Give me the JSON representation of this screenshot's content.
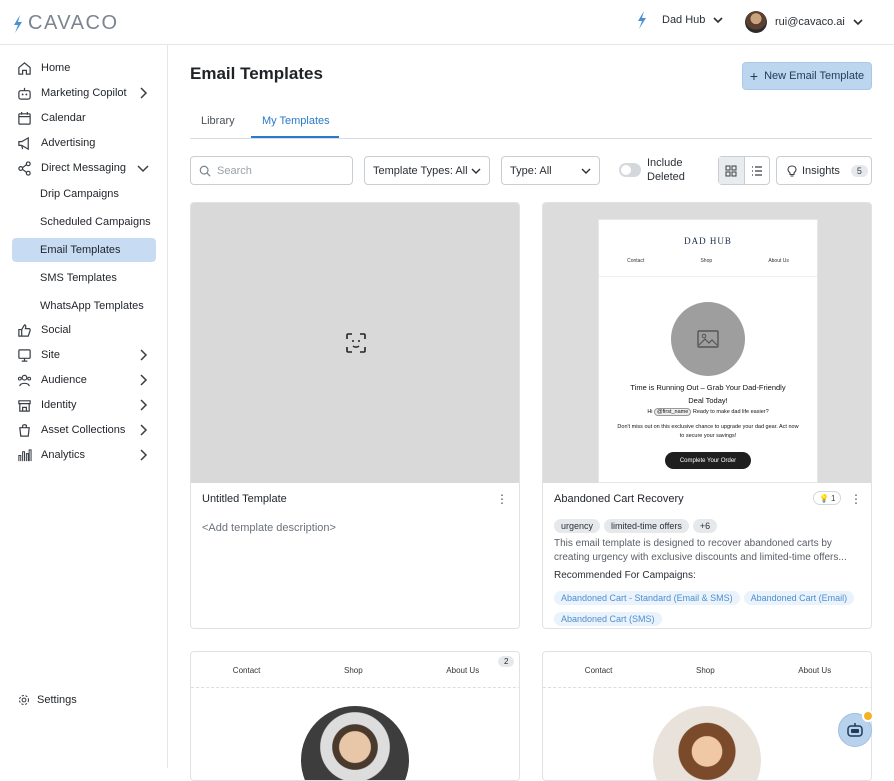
{
  "brand": {
    "name": "CAVACO",
    "accent": "#2a7ac8",
    "logo_color": "#4d8fcf"
  },
  "header": {
    "workspace": "Dad Hub",
    "user_email": "rui@cavaco.ai"
  },
  "sidebar": {
    "items": [
      {
        "label": "Home",
        "icon": "home-icon"
      },
      {
        "label": "Marketing Copilot",
        "icon": "robot-icon"
      },
      {
        "label": "Calendar",
        "icon": "calendar-icon"
      },
      {
        "label": "Advertising",
        "icon": "megaphone-icon"
      },
      {
        "label": "Direct Messaging",
        "icon": "share-icon"
      },
      {
        "label": "Social",
        "icon": "thumbs-up-icon"
      },
      {
        "label": "Site",
        "icon": "monitor-icon"
      },
      {
        "label": "Audience",
        "icon": "users-icon"
      },
      {
        "label": "Identity",
        "icon": "store-icon"
      },
      {
        "label": "Asset Collections",
        "icon": "bag-icon"
      },
      {
        "label": "Analytics",
        "icon": "bar-chart-icon"
      }
    ],
    "sub_items": [
      {
        "label": "Drip Campaigns"
      },
      {
        "label": "Scheduled Campaigns"
      },
      {
        "label": "Email Templates",
        "active": true
      },
      {
        "label": "SMS Templates"
      },
      {
        "label": "WhatsApp Templates"
      }
    ],
    "settings_label": "Settings"
  },
  "page": {
    "title": "Email Templates",
    "new_button": "New Email Template",
    "tabs": [
      {
        "label": "Library"
      },
      {
        "label": "My Templates",
        "active": true
      }
    ]
  },
  "filters": {
    "search_placeholder": "Search",
    "template_types": "Template Types: All",
    "type": "Type: All",
    "include_deleted": "Include Deleted",
    "insights_label": "Insights",
    "insights_count": "5"
  },
  "cards": [
    {
      "title": "Untitled Template",
      "description": "<Add template description>"
    },
    {
      "title": "Abandoned Cart Recovery",
      "insight_count": "1",
      "tags": [
        "urgency",
        "limited-time offers",
        "+6"
      ],
      "description": "This email template is designed to recover abandoned carts by creating urgency with exclusive discounts and limited-time offers...",
      "recommended_label": "Recommended For Campaigns:",
      "recommended": [
        "Abandoned Cart - Standard (Email & SMS)",
        "Abandoned Cart (Email)",
        "Abandoned Cart (SMS)"
      ],
      "preview": {
        "brand": "DAD HUB",
        "nav": [
          "Contact",
          "Shop",
          "About Us"
        ],
        "headline": "Time is Running Out – Grab Your Dad-Friendly Deal Today!",
        "greeting_prefix": "Hi",
        "greeting_tag": "@first_name",
        "greeting_suffix": "Ready to make dad life easier?",
        "body": "Don't miss out on this exclusive chance to upgrade your dad gear. Act now to secure your savings!",
        "cta": "Complete Your Order"
      }
    },
    {
      "nav": [
        "Contact",
        "Shop",
        "About Us"
      ],
      "count": "2"
    },
    {
      "nav": [
        "Contact",
        "Shop",
        "About Us"
      ]
    }
  ]
}
